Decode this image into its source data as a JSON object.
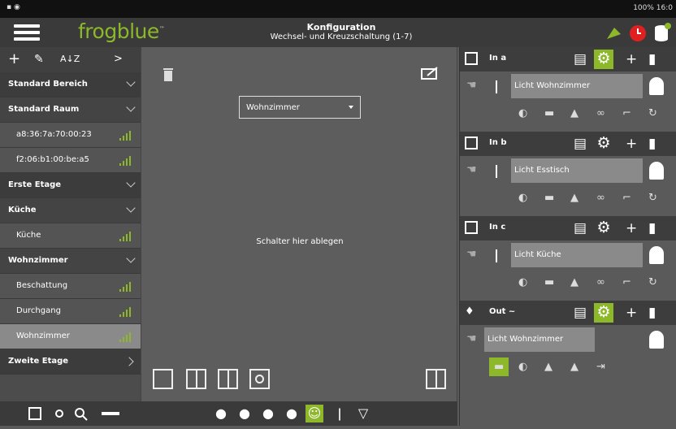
{
  "status": {
    "right": "100% 16:0"
  },
  "topbar": {
    "logo": "frogblue",
    "title": "Konfiguration",
    "subtitle": "Wechsel- und Kreuzschaltung (1-7)"
  },
  "left": {
    "header": {
      "add": "+",
      "edit": "✎",
      "sort": "A↓Z",
      "expand": ">"
    },
    "rows": [
      {
        "label": "Standard Bereich",
        "type": "area"
      },
      {
        "label": "Standard Raum",
        "type": "room"
      },
      {
        "label": "a8:36:7a:70:00:23",
        "type": "item"
      },
      {
        "label": "f2:06:b1:00:be:a5",
        "type": "item"
      },
      {
        "label": "Erste Etage",
        "type": "area"
      },
      {
        "label": "Küche",
        "type": "room"
      },
      {
        "label": "Küche",
        "type": "item"
      },
      {
        "label": "Wohnzimmer",
        "type": "room"
      },
      {
        "label": "Beschattung",
        "type": "item"
      },
      {
        "label": "Durchgang",
        "type": "item"
      },
      {
        "label": "Wohnzimmer",
        "type": "item",
        "selected": true
      },
      {
        "label": "Zweite Etage",
        "type": "area"
      }
    ]
  },
  "center": {
    "room_select": "Wohnzimmer",
    "drop_hint": "Schalter hier ablegen"
  },
  "right": {
    "sections": [
      {
        "name": "In a",
        "gear_active": true,
        "action": "Licht Wohnzimmer"
      },
      {
        "name": "In b",
        "gear_active": false,
        "action": "Licht Esstisch"
      },
      {
        "name": "In c",
        "gear_active": false,
        "action": "Licht Küche"
      },
      {
        "name": "Out ~",
        "gear_active": true,
        "action": "Licht Wohnzimmer"
      }
    ]
  },
  "colors": {
    "accent": "#8cb82a"
  }
}
